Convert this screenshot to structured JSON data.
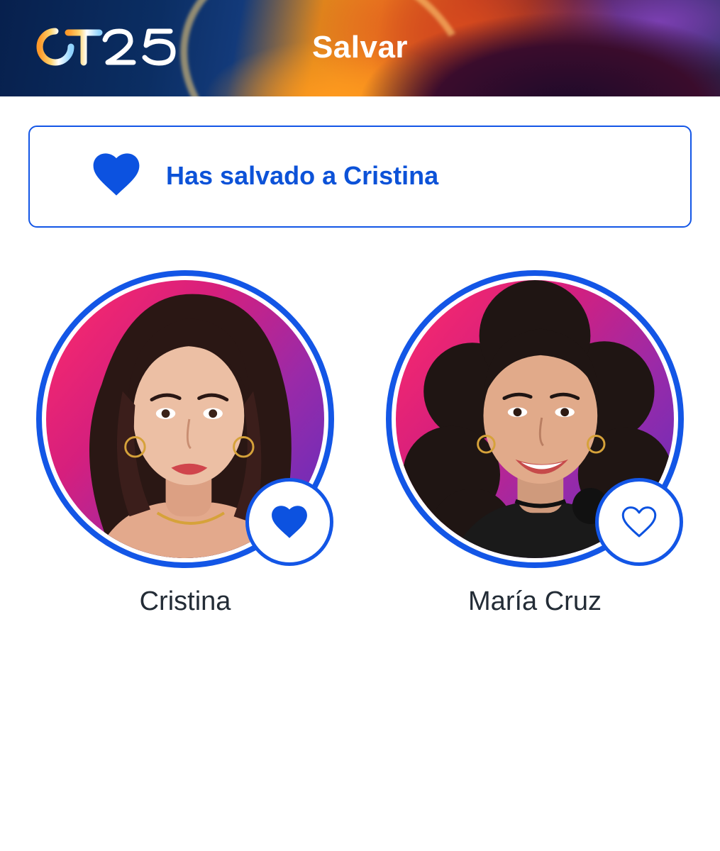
{
  "header": {
    "logo_text": "OT25",
    "title": "Salvar"
  },
  "banner": {
    "icon": "heart-filled-icon",
    "message": "Has salvado a Cristina"
  },
  "contestants": [
    {
      "name": "Cristina",
      "saved": true,
      "badge_icon": "heart-filled-icon"
    },
    {
      "name": "María Cruz",
      "saved": false,
      "badge_icon": "heart-outline-icon"
    }
  ],
  "colors": {
    "accent": "#1356e6",
    "banner_text": "#0c52d8",
    "name_text": "#232c36",
    "photo_bg_start": "#ff2b6a",
    "photo_bg_end": "#5d2fc0"
  }
}
